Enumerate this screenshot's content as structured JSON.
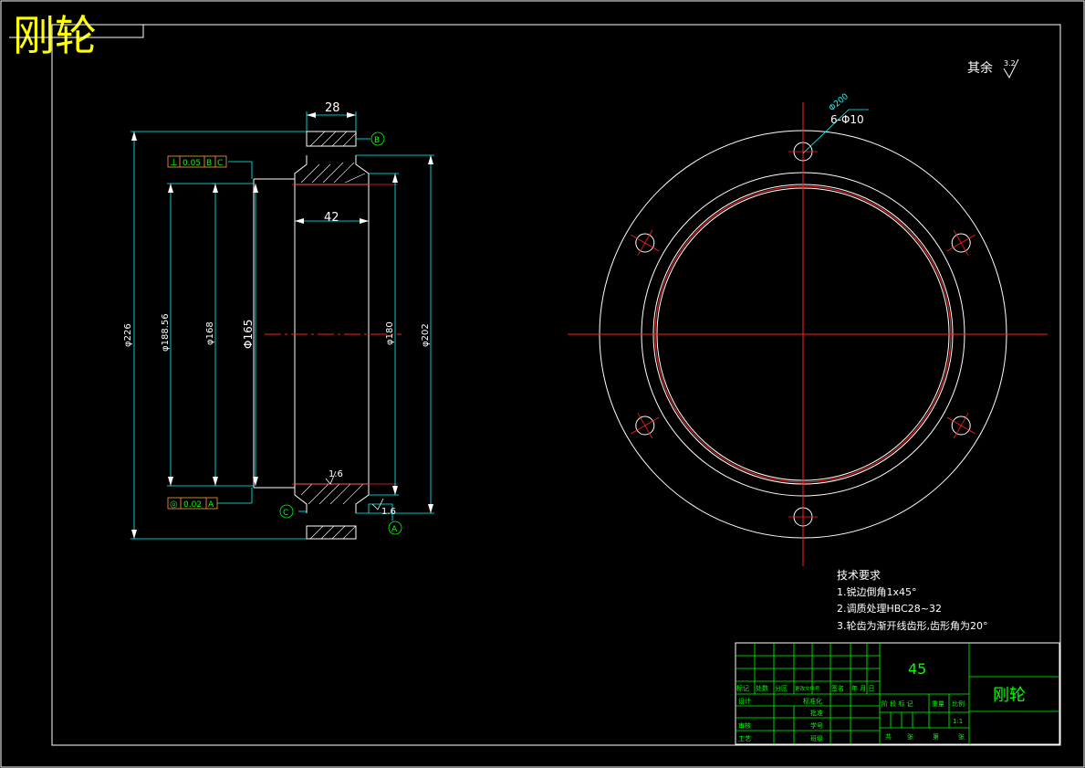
{
  "title": "刚轮",
  "roughness_note": {
    "label": "其余",
    "value": "3.2"
  },
  "holes": {
    "callout": "6-Φ10",
    "pcd": "Φ200"
  },
  "dims": {
    "width_top": "28",
    "bore_length": "42",
    "d226": "φ226",
    "d188": "φ188.56",
    "d168": "φ168",
    "d165": "Φ165",
    "d180": "φ180",
    "d202": "φ202",
    "rough_bore": "1.6",
    "rough_face": "1.6"
  },
  "tolerances": {
    "perp": {
      "symbol": "⊥",
      "value": "0.05",
      "datum1": "B",
      "datum2": "C"
    },
    "coax": {
      "symbol": "◎",
      "value": "0.02",
      "datum1": "A"
    }
  },
  "datums": {
    "b": "B",
    "c": "C",
    "a": "A"
  },
  "tech_requirements": {
    "heading": "技术要求",
    "items": [
      "1.锐边倒角1x45°",
      "2.调质处理HBC28~32",
      "3.轮齿为渐开线齿形,齿形角为20°"
    ]
  },
  "title_block": {
    "material": "45",
    "part_name": "刚轮",
    "header_row": [
      "标记",
      "处数",
      "分区",
      "更改文件号",
      "签名",
      "年 月 日"
    ],
    "roles": [
      "设计",
      "审核",
      "工艺"
    ],
    "role_mid": [
      "标准化",
      "批准",
      "学号",
      "班级"
    ],
    "stage_row": [
      "阶 段 标 记",
      "重量",
      "比例"
    ],
    "scale": "1:1",
    "sheet_row": [
      "共",
      "张",
      "第",
      "张"
    ]
  }
}
